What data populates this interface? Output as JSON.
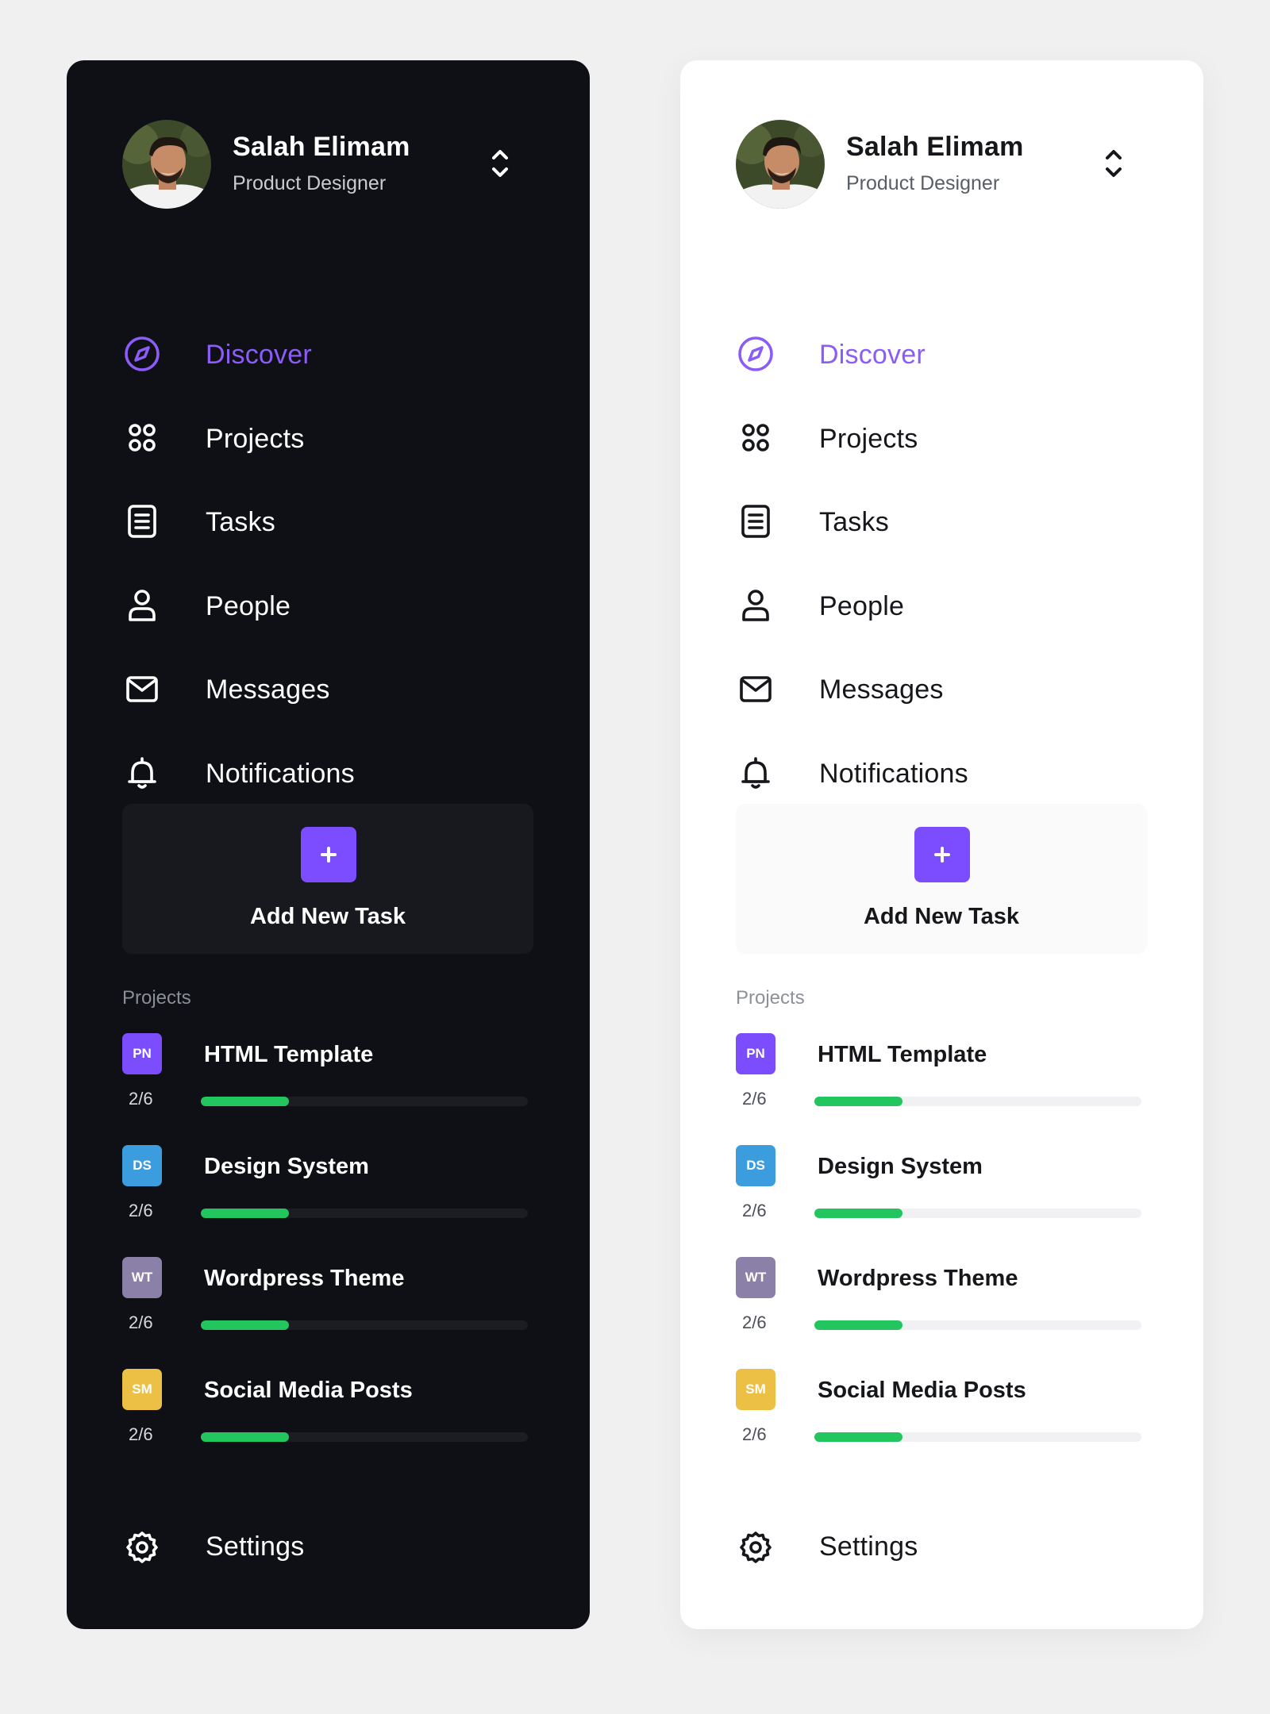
{
  "colors": {
    "accent": "#8b5cf6",
    "plus_button": "#7c4dff",
    "progress": "#22c55e",
    "dark_panel": "#0e1015",
    "light_panel": "#ffffff",
    "page_background": "#f0f0f1"
  },
  "profile": {
    "name": "Salah Elimam",
    "role": "Product Designer",
    "switch_icon": "chevron-up-down-icon"
  },
  "nav": {
    "items": [
      {
        "label": "Discover",
        "icon": "compass-icon",
        "active": true
      },
      {
        "label": "Projects",
        "icon": "grid-dots-icon",
        "active": false
      },
      {
        "label": "Tasks",
        "icon": "document-list-icon",
        "active": false
      },
      {
        "label": "People",
        "icon": "user-icon",
        "active": false
      },
      {
        "label": "Messages",
        "icon": "mail-icon",
        "active": false
      },
      {
        "label": "Notifications",
        "icon": "bell-icon",
        "active": false
      }
    ]
  },
  "add_task": {
    "label": "Add New Task",
    "icon": "plus-icon"
  },
  "projects": {
    "heading": "Projects",
    "items": [
      {
        "badge": "PN",
        "badge_color": "#7c4dff",
        "name": "HTML Template",
        "count": "2/6",
        "progress": 0.27
      },
      {
        "badge": "DS",
        "badge_color": "#3b9ddd",
        "name": "Design System",
        "count": "2/6",
        "progress": 0.27
      },
      {
        "badge": "WT",
        "badge_color": "#8b80a8",
        "name": "Wordpress Theme",
        "count": "2/6",
        "progress": 0.27
      },
      {
        "badge": "SM",
        "badge_color": "#ecbf45",
        "name": "Social Media Posts",
        "count": "2/6",
        "progress": 0.27
      }
    ]
  },
  "settings": {
    "label": "Settings",
    "icon": "gear-icon"
  }
}
